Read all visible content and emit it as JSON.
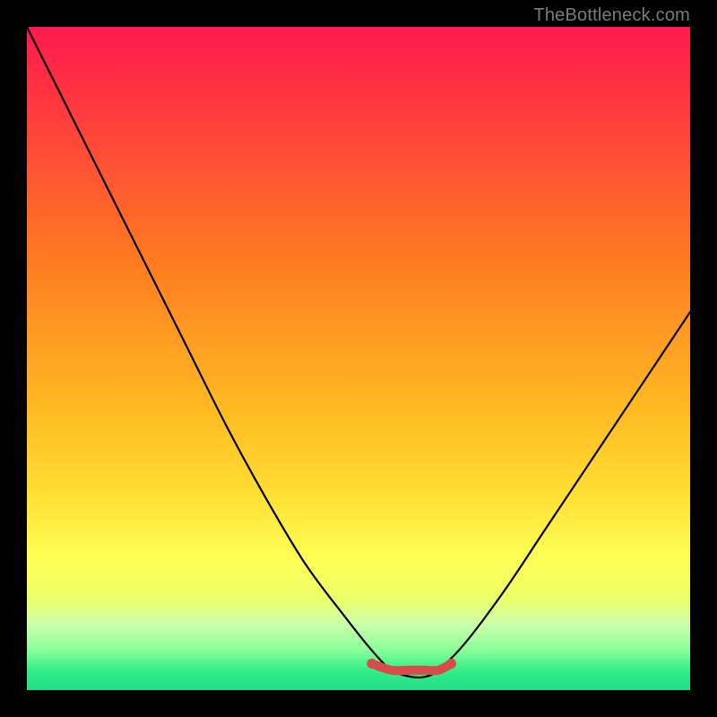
{
  "watermark": "TheBottleneck.com",
  "chart_data": {
    "type": "line",
    "title": "",
    "xlabel": "",
    "ylabel": "",
    "xlim": [
      0,
      100
    ],
    "ylim": [
      0,
      100
    ],
    "grid": false,
    "legend": false,
    "series": [
      {
        "name": "black-curve",
        "color": "#000000",
        "x": [
          0,
          6,
          12,
          18,
          24,
          30,
          36,
          42,
          48,
          52,
          55,
          58,
          60,
          62,
          66,
          72,
          78,
          84,
          90,
          96,
          100
        ],
        "values": [
          100,
          88,
          76,
          64,
          52,
          40,
          29,
          19,
          11,
          6,
          3,
          2,
          2,
          3,
          7,
          15,
          24,
          33,
          42,
          51,
          57
        ]
      },
      {
        "name": "red-flat-segment",
        "color": "#d94a4a",
        "x": [
          52,
          55,
          58,
          60,
          62,
          64
        ],
        "values": [
          4,
          3,
          3,
          3,
          3,
          4
        ]
      }
    ],
    "colors": {
      "gradient_top": "#ff1a4d",
      "gradient_mid": "#ffdd33",
      "gradient_bottom": "#22dd88",
      "frame": "#000000",
      "curve": "#000000",
      "flat_segment": "#d94a4a"
    }
  }
}
